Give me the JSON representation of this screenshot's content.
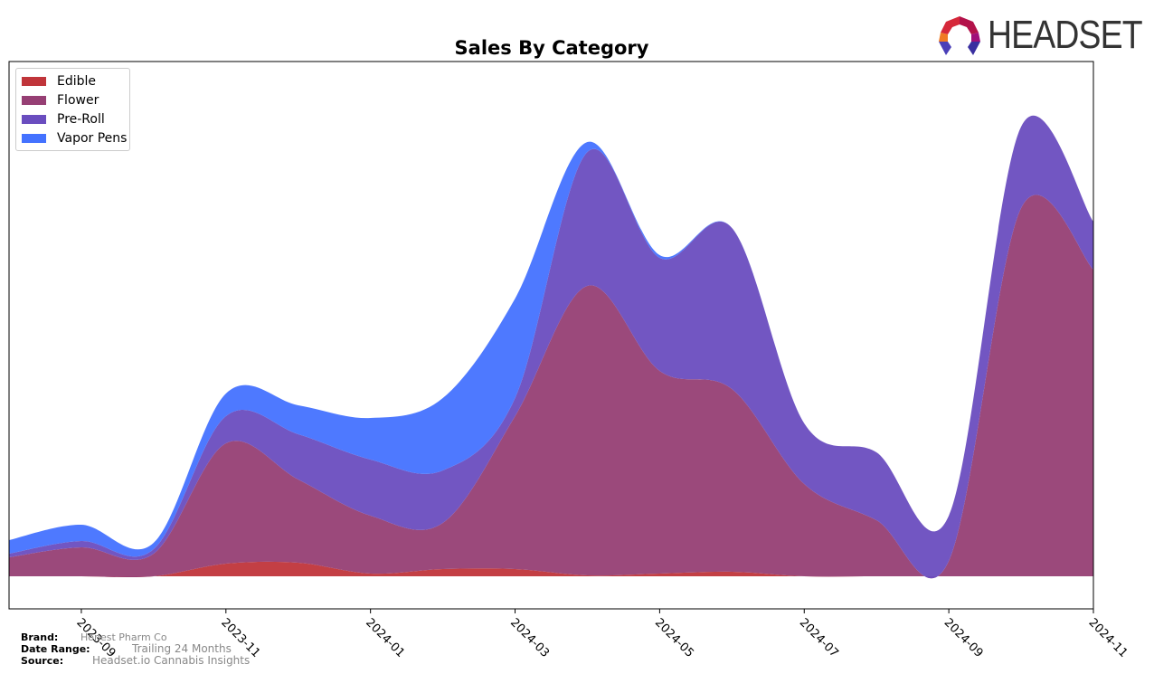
{
  "chart_data": {
    "type": "area",
    "title": "Sales By Category",
    "xlabel": "",
    "ylabel": "",
    "x": [
      "2023-08",
      "2023-09",
      "2023-10",
      "2023-11",
      "2023-12",
      "2024-01",
      "2024-02",
      "2024-03",
      "2024-04",
      "2024-05",
      "2024-06",
      "2024-07",
      "2024-08",
      "2024-09",
      "2024-10",
      "2024-11"
    ],
    "tick_labels": [
      "2023-09",
      "2023-11",
      "2024-01",
      "2024-03",
      "2024-05",
      "2024-07",
      "2024-09",
      "2024-11"
    ],
    "stacked": true,
    "ylim": [
      -36,
      569
    ],
    "grid": false,
    "legend_position": "top-left",
    "series": [
      {
        "name": "Edible",
        "color": "#c0353a",
        "values": [
          0,
          0,
          0,
          14,
          15,
          3,
          8,
          8,
          1,
          3,
          5,
          0,
          0,
          0,
          0,
          0
        ]
      },
      {
        "name": "Flower",
        "color": "#963f74",
        "values": [
          21,
          32,
          25,
          133,
          92,
          64,
          51,
          169,
          320,
          224,
          202,
          102,
          62,
          17,
          407,
          339
        ]
      },
      {
        "name": "Pre-Roll",
        "color": "#6a4dbf",
        "values": [
          4,
          7,
          5,
          30,
          50,
          62,
          58,
          20,
          148,
          125,
          178,
          67,
          75,
          50,
          90,
          53
        ]
      },
      {
        "name": "Vapor Pens",
        "color": "#4472ff",
        "values": [
          15,
          18,
          7,
          25,
          32,
          46,
          80,
          110,
          11,
          3,
          0,
          0,
          0,
          0,
          0,
          0
        ]
      }
    ]
  },
  "footer": {
    "brand_label": "Brand:",
    "brand": "Honest Pharm Co",
    "range_label": "Date Range:",
    "range": "Trailing 24 Months",
    "source_label": "Source:",
    "source": "Headset.io Cannabis Insights"
  },
  "logo": {
    "text": "HEADSET"
  }
}
